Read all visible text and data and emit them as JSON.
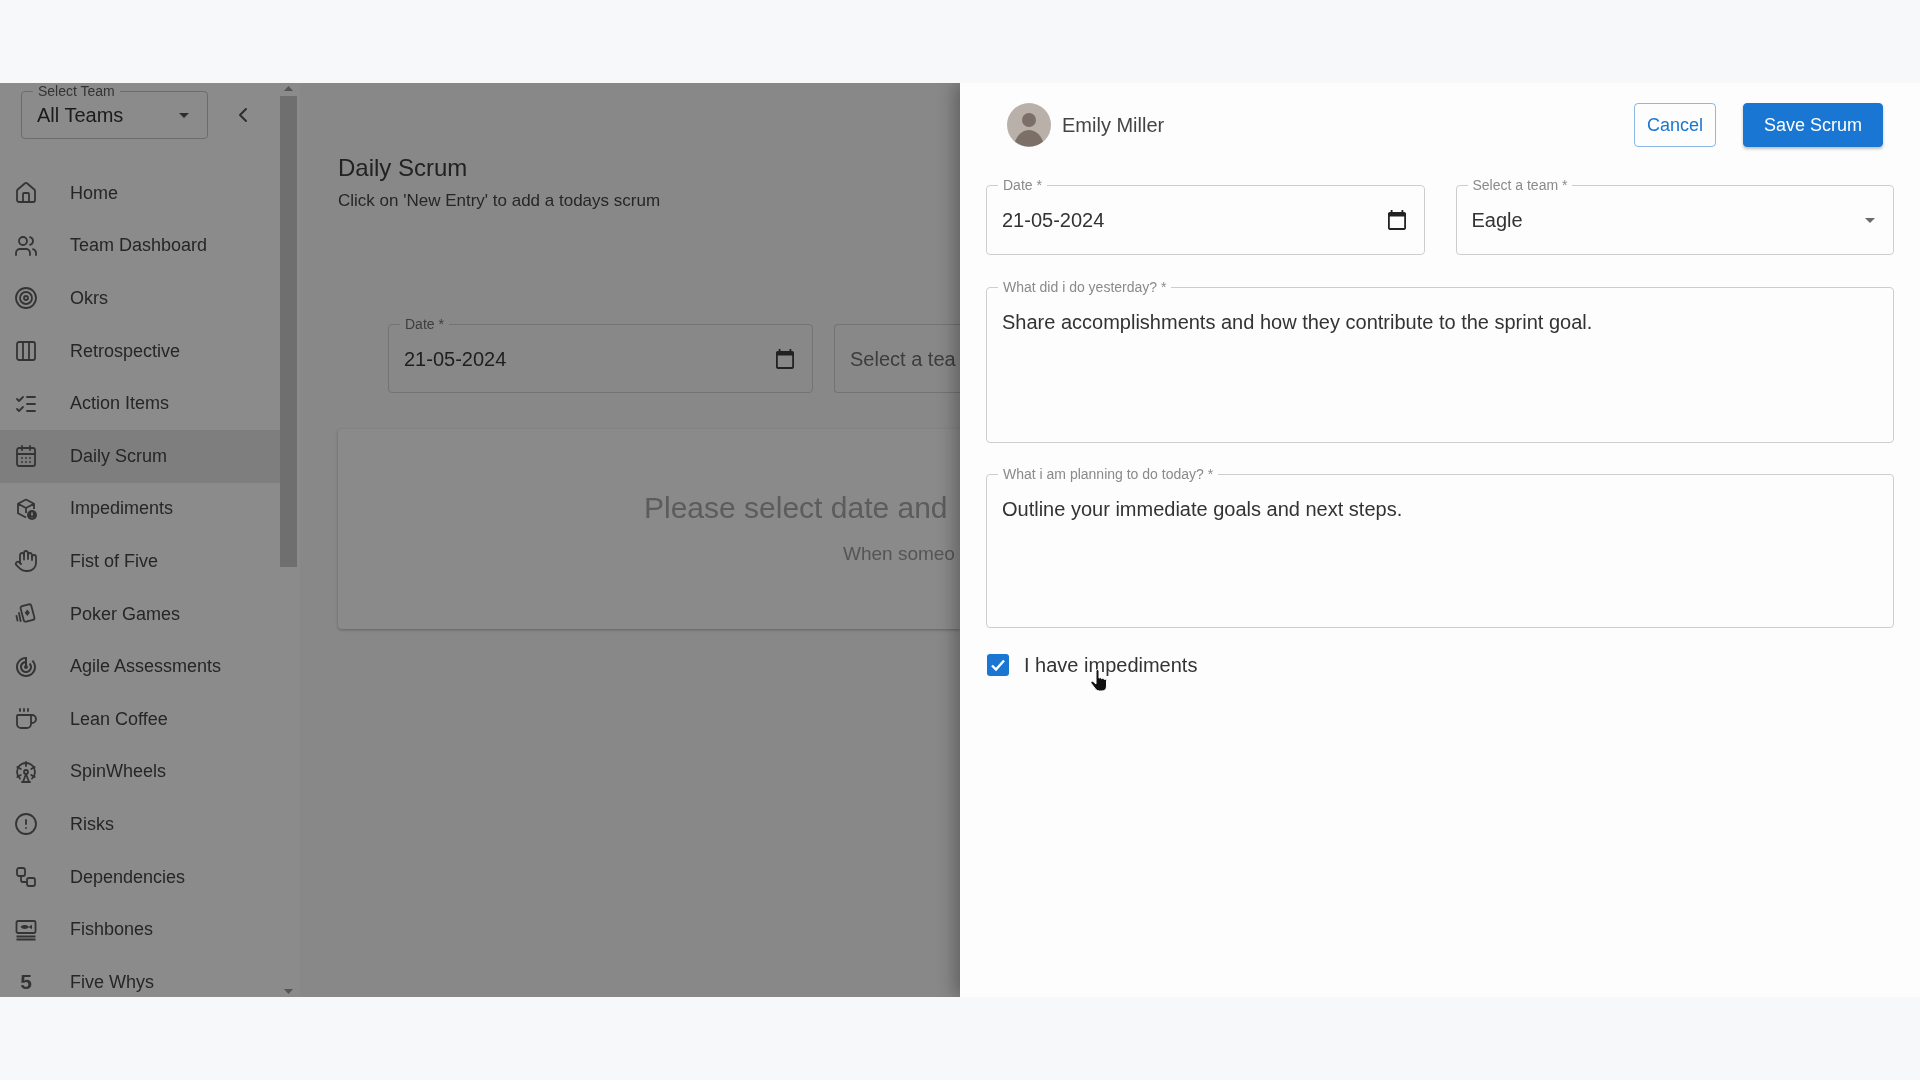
{
  "team_select": {
    "label": "Select Team",
    "value": "All Teams"
  },
  "sidebar": {
    "items": [
      {
        "label": "Home",
        "selected": false
      },
      {
        "label": "Team Dashboard",
        "selected": false
      },
      {
        "label": "Okrs",
        "selected": false
      },
      {
        "label": "Retrospective",
        "selected": false
      },
      {
        "label": "Action Items",
        "selected": false
      },
      {
        "label": "Daily Scrum",
        "selected": true
      },
      {
        "label": "Impediments",
        "selected": false
      },
      {
        "label": "Fist of Five",
        "selected": false
      },
      {
        "label": "Poker Games",
        "selected": false
      },
      {
        "label": "Agile Assessments",
        "selected": false
      },
      {
        "label": "Lean Coffee",
        "selected": false
      },
      {
        "label": "SpinWheels",
        "selected": false
      },
      {
        "label": "Risks",
        "selected": false
      },
      {
        "label": "Dependencies",
        "selected": false
      },
      {
        "label": "Fishbones",
        "selected": false
      },
      {
        "label": "Five Whys",
        "selected": false,
        "glyph": "5"
      }
    ]
  },
  "page": {
    "title": "Daily Scrum",
    "subtitle": "Click on 'New Entry' to add a todays scrum",
    "date_field": {
      "label": "Date *",
      "value": "21-05-2024"
    },
    "team_field": {
      "label": "Select a tea"
    },
    "empty_state": {
      "title": "Please select date and",
      "text": "When someo"
    }
  },
  "drawer": {
    "user": {
      "name": "Emily Miller"
    },
    "buttons": [
      {
        "label": "Cancel",
        "kind": "outlined"
      },
      {
        "label": "Save Scrum",
        "kind": "contained"
      }
    ],
    "date_field": {
      "label": "Date *",
      "value": "21-05-2024"
    },
    "team_field": {
      "label": "Select a team *",
      "value": "Eagle"
    },
    "yesterday_field": {
      "label": "What did i do yesterday? *",
      "value": "Share accomplishments and how they contribute to the sprint goal."
    },
    "today_field": {
      "label": "What i am planning to do today? *",
      "value": "Outline your immediate goals and next steps."
    },
    "impediments": {
      "label": "I have impediments",
      "checked": true
    }
  }
}
